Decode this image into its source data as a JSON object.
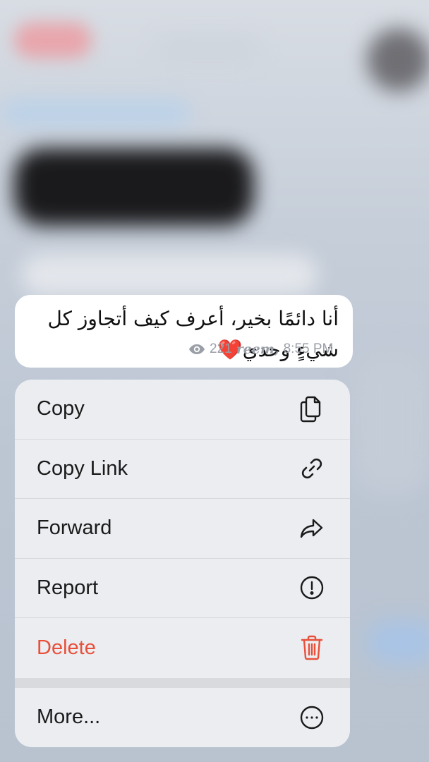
{
  "message": {
    "text": "أنا دائمًا بخير، أعرف كيف أتجاوز كل شيءٍ وحدي❤️",
    "views": "221",
    "author": "reem,",
    "time": "8:55 PM"
  },
  "menu": {
    "items": [
      {
        "label": "Copy",
        "icon": "copy-icon"
      },
      {
        "label": "Copy Link",
        "icon": "link-icon"
      },
      {
        "label": "Forward",
        "icon": "forward-icon"
      },
      {
        "label": "Report",
        "icon": "report-icon"
      },
      {
        "label": "Delete",
        "icon": "trash-icon"
      }
    ],
    "more": {
      "label": "More...",
      "icon": "more-icon"
    }
  },
  "colors": {
    "delete": "#e8503a",
    "meta": "#9a9ea6"
  }
}
